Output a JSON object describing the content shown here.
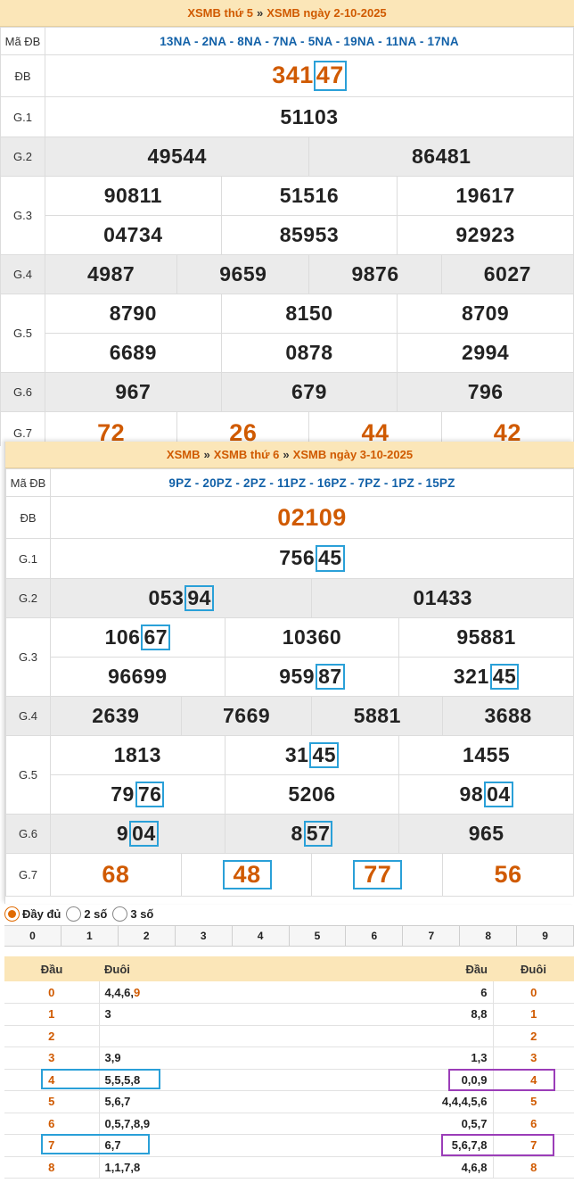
{
  "panel1": {
    "title": {
      "left": "XSMB thứ 5",
      "sep": "»",
      "right": "XSMB ngày 2-10-2025"
    },
    "ma_db_label": "Mã ĐB",
    "ma_db_codes": "13NA - 2NA - 8NA - 7NA - 5NA - 19NA - 11NA - 17NA",
    "rows": {
      "db": {
        "label": "ĐB",
        "prefix": "341",
        "hl": "47"
      },
      "g1": {
        "label": "G.1",
        "values": [
          "51103"
        ]
      },
      "g2": {
        "label": "G.2",
        "values": [
          "49544",
          "86481"
        ]
      },
      "g3": {
        "label": "G.3",
        "values": [
          "90811",
          "51516",
          "19617",
          "04734",
          "85953",
          "92923"
        ]
      },
      "g4": {
        "label": "G.4",
        "values": [
          "4987",
          "9659",
          "9876",
          "6027"
        ]
      },
      "g5": {
        "label": "G.5",
        "values": [
          "8790",
          "8150",
          "8709",
          "6689",
          "0878",
          "2994"
        ]
      },
      "g6": {
        "label": "G.6",
        "values": [
          "967",
          "679",
          "796"
        ]
      },
      "g7": {
        "label": "G.7",
        "values": [
          "72",
          "26",
          "44",
          "42"
        ]
      }
    }
  },
  "panel2": {
    "title": {
      "a": "XSMB",
      "b": "XSMB thứ 6",
      "c": "XSMB ngày 3-10-2025",
      "sep": "»"
    },
    "ma_db_label": "Mã ĐB",
    "ma_db_codes": "9PZ - 20PZ - 2PZ - 11PZ - 16PZ - 7PZ - 1PZ - 15PZ",
    "rows": {
      "db": {
        "label": "ĐB",
        "value": "02109"
      },
      "g1": {
        "label": "G.1",
        "pre": "756",
        "hl": "45"
      },
      "g2": {
        "label": "G.2",
        "a_pre": "053",
        "a_hl": "94",
        "b": "01433"
      },
      "g3": {
        "label": "G.3",
        "r1": {
          "a_pre": "106",
          "a_hl": "67",
          "b": "10360",
          "c": "95881"
        },
        "r2": {
          "a": "96699",
          "b_pre": "959",
          "b_hl": "87",
          "c_pre": "321",
          "c_hl": "45"
        }
      },
      "g4": {
        "label": "G.4",
        "values": [
          "2639",
          "7669",
          "5881",
          "3688"
        ]
      },
      "g5": {
        "label": "G.5",
        "r1": {
          "a": "1813",
          "b_pre": "31",
          "b_hl": "45",
          "c": "1455"
        },
        "r2": {
          "a_pre": "79",
          "a_hl": "76",
          "b": "5206",
          "c_pre": "98",
          "c_hl": "04"
        }
      },
      "g6": {
        "label": "G.6",
        "a_pre": "9",
        "a_hl": "04",
        "b_pre": "8",
        "b_hl": "57",
        "c": "965"
      },
      "g7": {
        "label": "G.7",
        "a": "68",
        "b": "48",
        "c": "77",
        "d": "56"
      }
    }
  },
  "mode": {
    "options": [
      "Đầy đủ",
      "2 số",
      "3 số"
    ],
    "selected": "Đầy đủ"
  },
  "digits": [
    "0",
    "1",
    "2",
    "3",
    "4",
    "5",
    "6",
    "7",
    "8",
    "9"
  ],
  "loto": {
    "left_headers": [
      "Đầu",
      "Đuôi"
    ],
    "right_headers": [
      "Đầu",
      "Đuôi"
    ],
    "left": [
      {
        "head": "0",
        "tail": "4,4,6,",
        "tail_hl": "9"
      },
      {
        "head": "1",
        "tail": "3",
        "tail_hl": ""
      },
      {
        "head": "2",
        "tail": "",
        "tail_hl": ""
      },
      {
        "head": "3",
        "tail": "3,9",
        "tail_hl": ""
      },
      {
        "head": "4",
        "tail": "5,5,5,8",
        "tail_hl": ""
      },
      {
        "head": "5",
        "tail": "5,6,7",
        "tail_hl": ""
      },
      {
        "head": "6",
        "tail": "0,5,7,8,9",
        "tail_hl": ""
      },
      {
        "head": "7",
        "tail": "6,7",
        "tail_hl": ""
      },
      {
        "head": "8",
        "tail": "1,1,7,8",
        "tail_hl": ""
      }
    ],
    "right": [
      {
        "heads": "6",
        "tail": "0"
      },
      {
        "heads": "8,8",
        "tail": "1"
      },
      {
        "heads": "",
        "tail": "2"
      },
      {
        "heads": "1,3",
        "tail": "3"
      },
      {
        "heads": "0,0,9",
        "tail": "4"
      },
      {
        "heads": "4,4,4,5,6",
        "tail": "5"
      },
      {
        "heads": "0,5,7",
        "tail": "6"
      },
      {
        "heads": "5,6,7,8",
        "tail": "7"
      },
      {
        "heads": "4,6,8",
        "tail": "8"
      }
    ]
  }
}
